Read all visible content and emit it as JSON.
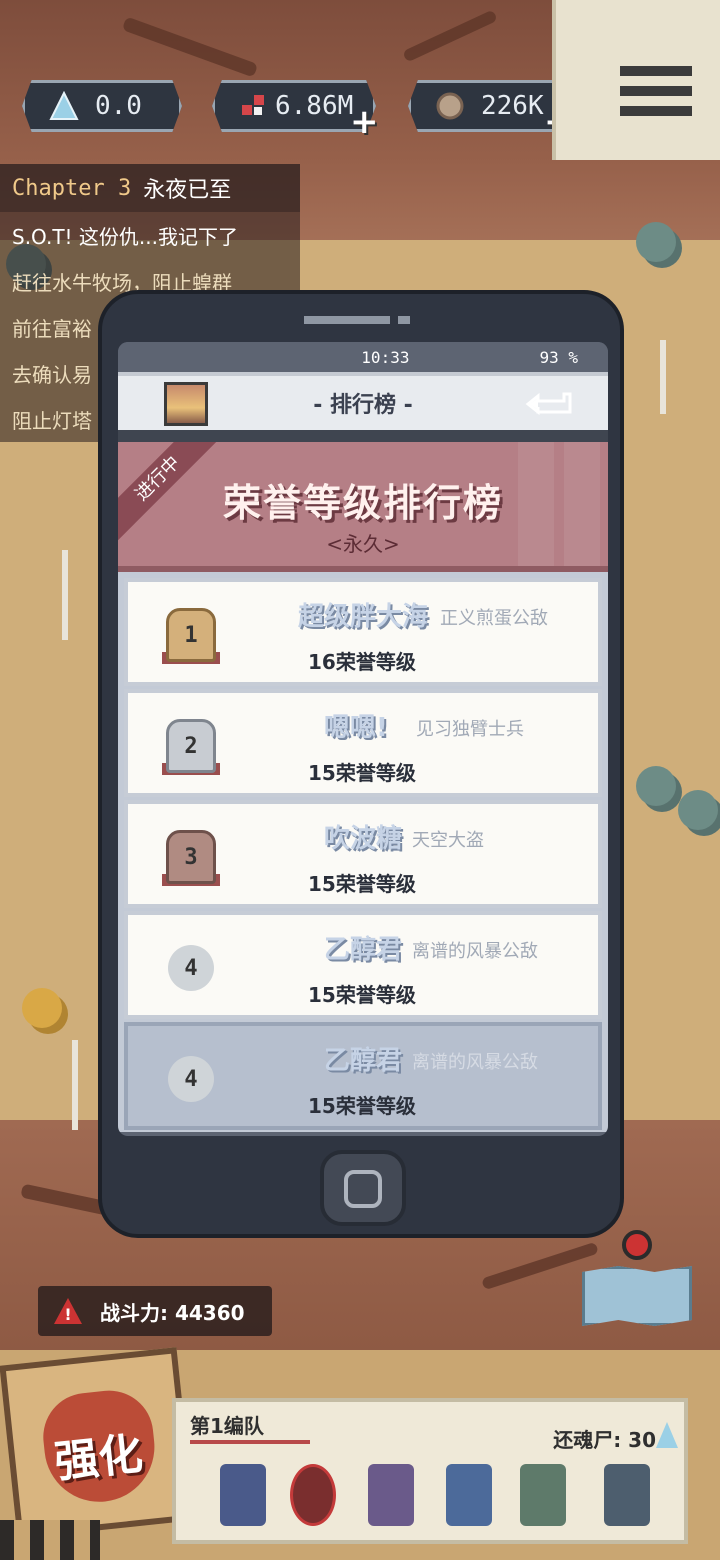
{
  "currencies": [
    {
      "icon": "crystal-icon",
      "value": "0.0"
    },
    {
      "icon": "dna-icon",
      "value": "6.86M"
    },
    {
      "icon": "coin-icon",
      "value": "226K"
    }
  ],
  "quests": {
    "chapter_label": "Chapter 3",
    "chapter_title": "永夜已至",
    "items": [
      "S.O.T! 这份仇...我记下了",
      "赶往水牛牧场，阻止蝗群",
      "前往富裕",
      "去确认易",
      "阻止灯塔"
    ]
  },
  "phone": {
    "time": "10:33",
    "battery": "93 %",
    "header_title": "- 排行榜 -",
    "back_icon": "back-arrow-icon",
    "banner_ribbon": "进行中",
    "banner_title": "荣誉等级排行榜",
    "banner_subtitle": "<永久>",
    "rows": [
      {
        "rank": "1",
        "name": "超级胖大海",
        "tag": "正义煎蛋公敌",
        "level": "16荣誉等级"
      },
      {
        "rank": "2",
        "name": "嗯嗯!",
        "tag": "见习独臂士兵",
        "level": "15荣誉等级"
      },
      {
        "rank": "3",
        "name": "吹波糖",
        "tag": "天空大盗",
        "level": "15荣誉等级"
      },
      {
        "rank": "4",
        "name": "乙醇君",
        "tag": "离谱的风暴公敌",
        "level": "15荣誉等级"
      },
      {
        "rank": "4",
        "name": "乙醇君",
        "tag": "离谱的风暴公敌",
        "level": "15荣誉等级"
      }
    ]
  },
  "hud": {
    "power_label": "战斗力: 44360",
    "enhance_label": "强化",
    "team_name": "第1编队",
    "soul_label": "还魂尸: 30"
  },
  "colors": {
    "banner": "#b57f86",
    "phone_body": "#2f3541",
    "rank_name": "#c6d3e6"
  }
}
